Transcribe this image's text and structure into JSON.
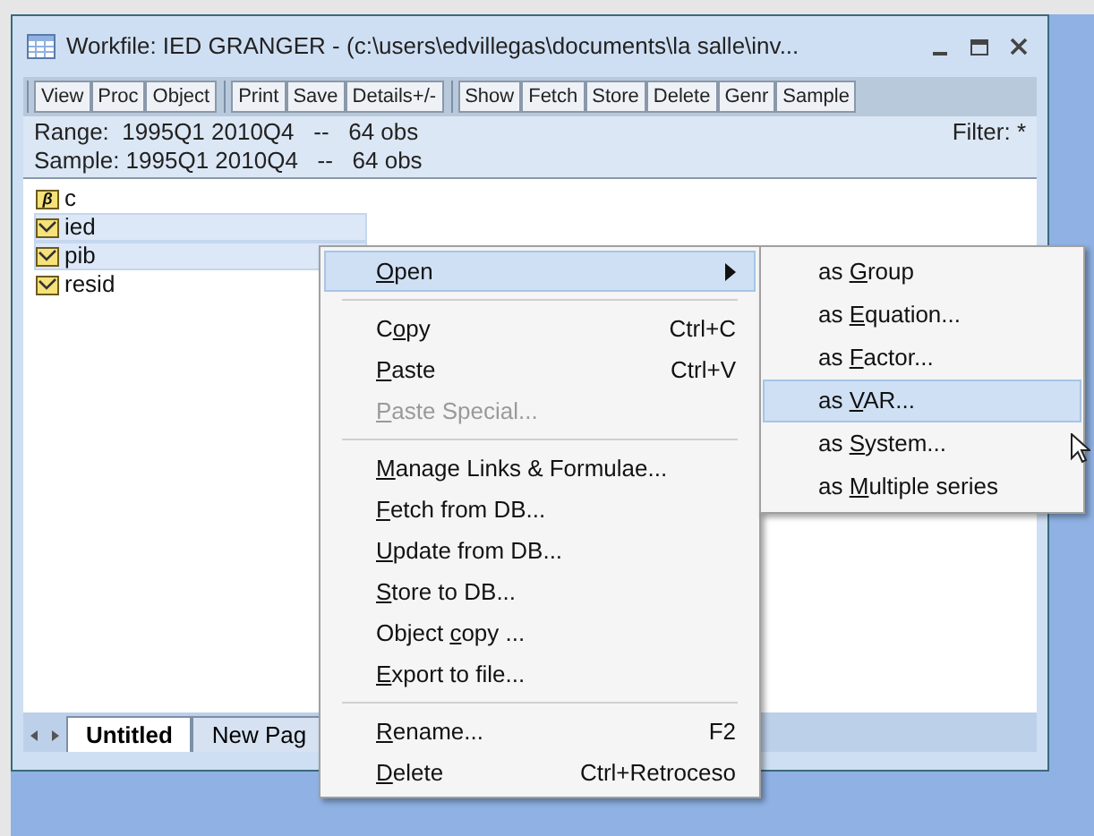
{
  "window": {
    "title": "Workfile: IED GRANGER - (c:\\users\\edvillegas\\documents\\la salle\\inv..."
  },
  "toolbar_groups": [
    [
      "View",
      "Proc",
      "Object"
    ],
    [
      "Print",
      "Save",
      "Details+/-"
    ],
    [
      "Show",
      "Fetch",
      "Store",
      "Delete",
      "Genr",
      "Sample"
    ]
  ],
  "info": {
    "range": "Range:  1995Q1 2010Q4   --   64 obs",
    "sample": "Sample: 1995Q1 2010Q4   --   64 obs",
    "filter": "Filter: *"
  },
  "objects": [
    {
      "name": "c",
      "kind": "coef",
      "icon_text": "β",
      "selected": false
    },
    {
      "name": "ied",
      "kind": "series",
      "selected": true
    },
    {
      "name": "pib",
      "kind": "series",
      "selected": true
    },
    {
      "name": "resid",
      "kind": "series",
      "selected": false
    }
  ],
  "page_tabs": [
    {
      "label": "Untitled",
      "selected": true
    },
    {
      "label": "New Pag",
      "selected": false
    }
  ],
  "context_menu": [
    {
      "key": "O",
      "after": "pen",
      "submenu": true,
      "selected": true,
      "disabled": false
    },
    {
      "kind": "separator"
    },
    {
      "before": "C",
      "key": "o",
      "after": "py",
      "shortcut": "Ctrl+C",
      "selected": false,
      "disabled": false
    },
    {
      "key": "P",
      "after": "aste",
      "shortcut": "Ctrl+V",
      "selected": false,
      "disabled": false
    },
    {
      "key": "P",
      "after": "aste Special...",
      "selected": false,
      "disabled": true
    },
    {
      "kind": "separator"
    },
    {
      "key": "M",
      "after": "anage Links & Formulae...",
      "selected": false,
      "disabled": false
    },
    {
      "key": "F",
      "after": "etch from DB...",
      "selected": false,
      "disabled": false
    },
    {
      "key": "U",
      "after": "pdate from DB...",
      "selected": false,
      "disabled": false
    },
    {
      "key": "S",
      "after": "tore to DB...",
      "selected": false,
      "disabled": false
    },
    {
      "before": "Object ",
      "key": "c",
      "after": "opy ...",
      "selected": false,
      "disabled": false
    },
    {
      "key": "E",
      "after": "xport to file...",
      "selected": false,
      "disabled": false
    },
    {
      "kind": "separator"
    },
    {
      "key": "R",
      "after": "ename...",
      "shortcut": "F2",
      "selected": false,
      "disabled": false
    },
    {
      "key": "D",
      "after": "elete",
      "shortcut": "Ctrl+Retroceso",
      "selected": false,
      "disabled": false
    }
  ],
  "submenu": [
    {
      "before": "as ",
      "key": "G",
      "after": "roup",
      "selected": false
    },
    {
      "before": "as ",
      "key": "E",
      "after": "quation...",
      "selected": false
    },
    {
      "before": "as ",
      "key": "F",
      "after": "actor...",
      "selected": false
    },
    {
      "before": "as ",
      "key": "V",
      "after": "AR...",
      "selected": true
    },
    {
      "before": "as ",
      "key": "S",
      "after": "ystem...",
      "selected": false
    },
    {
      "before": "as ",
      "key": "M",
      "after": "ultiple series",
      "selected": false
    }
  ]
}
